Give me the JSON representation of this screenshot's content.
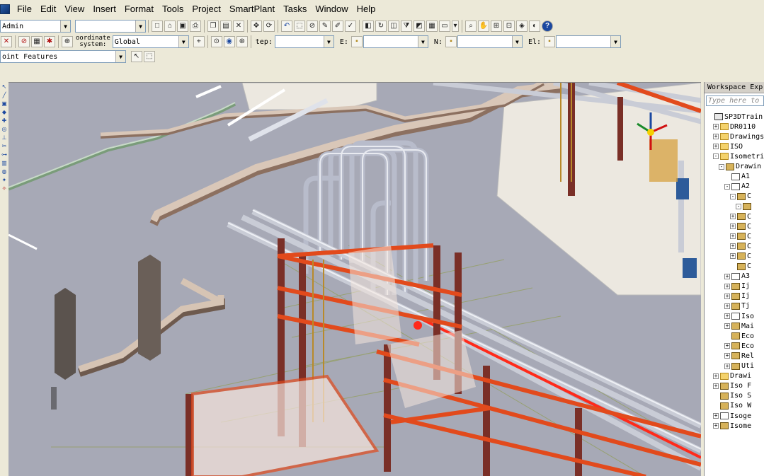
{
  "menu": [
    "File",
    "Edit",
    "View",
    "Insert",
    "Format",
    "Tools",
    "Project",
    "SmartPlant",
    "Tasks",
    "Window",
    "Help"
  ],
  "toolbar1": {
    "permission_group": "Admin",
    "active_filter": ""
  },
  "toolbar2": {
    "coord_label_line1": "oordinate",
    "coord_label_line2": "system:",
    "coord_system": "Global",
    "step_label": "tep:",
    "step_value": "",
    "e_label": "E:",
    "e_value": "",
    "n_label": "N:",
    "n_value": "",
    "el_label": "El:",
    "el_value": ""
  },
  "toolbar3": {
    "locate_filter": "oint Features"
  },
  "explorer": {
    "title": "Workspace Exp",
    "search_placeholder": "Type here to",
    "tree": [
      {
        "label": "SP3DTrain",
        "icon": "computer-icon",
        "depth": 0,
        "toggle": ""
      },
      {
        "label": "DR0110",
        "icon": "folder-icon",
        "depth": 1,
        "toggle": "+"
      },
      {
        "label": "Drawings",
        "icon": "folder-icon",
        "depth": 1,
        "toggle": "+"
      },
      {
        "label": "ISO",
        "icon": "folder-icon",
        "depth": 1,
        "toggle": "+"
      },
      {
        "label": "Isometric",
        "icon": "folder-icon",
        "depth": 1,
        "toggle": "-"
      },
      {
        "label": "Drawin",
        "icon": "drawing-icon",
        "depth": 2,
        "toggle": "-"
      },
      {
        "label": "A1",
        "icon": "doc-icon",
        "depth": 3,
        "toggle": ""
      },
      {
        "label": "A2",
        "icon": "doc-icon",
        "depth": 3,
        "toggle": "-"
      },
      {
        "label": "C",
        "icon": "drawing-icon",
        "depth": 4,
        "toggle": "-"
      },
      {
        "label": "",
        "icon": "drawing-icon",
        "depth": 5,
        "toggle": "-"
      },
      {
        "label": "C",
        "icon": "drawing-icon",
        "depth": 4,
        "toggle": "+"
      },
      {
        "label": "C",
        "icon": "drawing-icon",
        "depth": 4,
        "toggle": "+"
      },
      {
        "label": "C",
        "icon": "drawing-icon",
        "depth": 4,
        "toggle": "+"
      },
      {
        "label": "C",
        "icon": "drawing-icon",
        "depth": 4,
        "toggle": "+"
      },
      {
        "label": "C",
        "icon": "drawing-icon",
        "depth": 4,
        "toggle": "+"
      },
      {
        "label": "C",
        "icon": "drawing-icon",
        "depth": 4,
        "toggle": ""
      },
      {
        "label": "A3",
        "icon": "doc-icon",
        "depth": 3,
        "toggle": "+"
      },
      {
        "label": "Ij",
        "icon": "drawing-icon",
        "depth": 3,
        "toggle": "+"
      },
      {
        "label": "Ij",
        "icon": "drawing-icon",
        "depth": 3,
        "toggle": "+"
      },
      {
        "label": "Tj",
        "icon": "drawing-icon",
        "depth": 3,
        "toggle": "+"
      },
      {
        "label": "Iso",
        "icon": "doc-icon",
        "depth": 3,
        "toggle": "+"
      },
      {
        "label": "Mai",
        "icon": "drawing-icon",
        "depth": 3,
        "toggle": "+"
      },
      {
        "label": "Eco",
        "icon": "drawing-icon",
        "depth": 3,
        "toggle": ""
      },
      {
        "label": "Eco",
        "icon": "drawing-icon",
        "depth": 3,
        "toggle": "+"
      },
      {
        "label": "Rel",
        "icon": "drawing-icon",
        "depth": 3,
        "toggle": "+"
      },
      {
        "label": "Uti",
        "icon": "drawing-icon",
        "depth": 3,
        "toggle": "+"
      },
      {
        "label": "Drawi",
        "icon": "folder-icon",
        "depth": 1,
        "toggle": "+"
      },
      {
        "label": "Iso F",
        "icon": "drawing-icon",
        "depth": 1,
        "toggle": "+"
      },
      {
        "label": "Iso S",
        "icon": "drawing-icon",
        "depth": 1,
        "toggle": ""
      },
      {
        "label": "Iso W",
        "icon": "drawing-icon",
        "depth": 1,
        "toggle": ""
      },
      {
        "label": "Isoge",
        "icon": "doc-icon",
        "depth": 1,
        "toggle": "+"
      },
      {
        "label": "Isome",
        "icon": "drawing-icon",
        "depth": 1,
        "toggle": "+"
      }
    ]
  },
  "colors": {
    "viewport_bg": "#a7a9b6",
    "pipe": "#c9ccd6",
    "steel": "#7a2f27",
    "selected": "#ff2a1a",
    "slab": "#ece8e0",
    "trench": "#d9c7b8"
  }
}
